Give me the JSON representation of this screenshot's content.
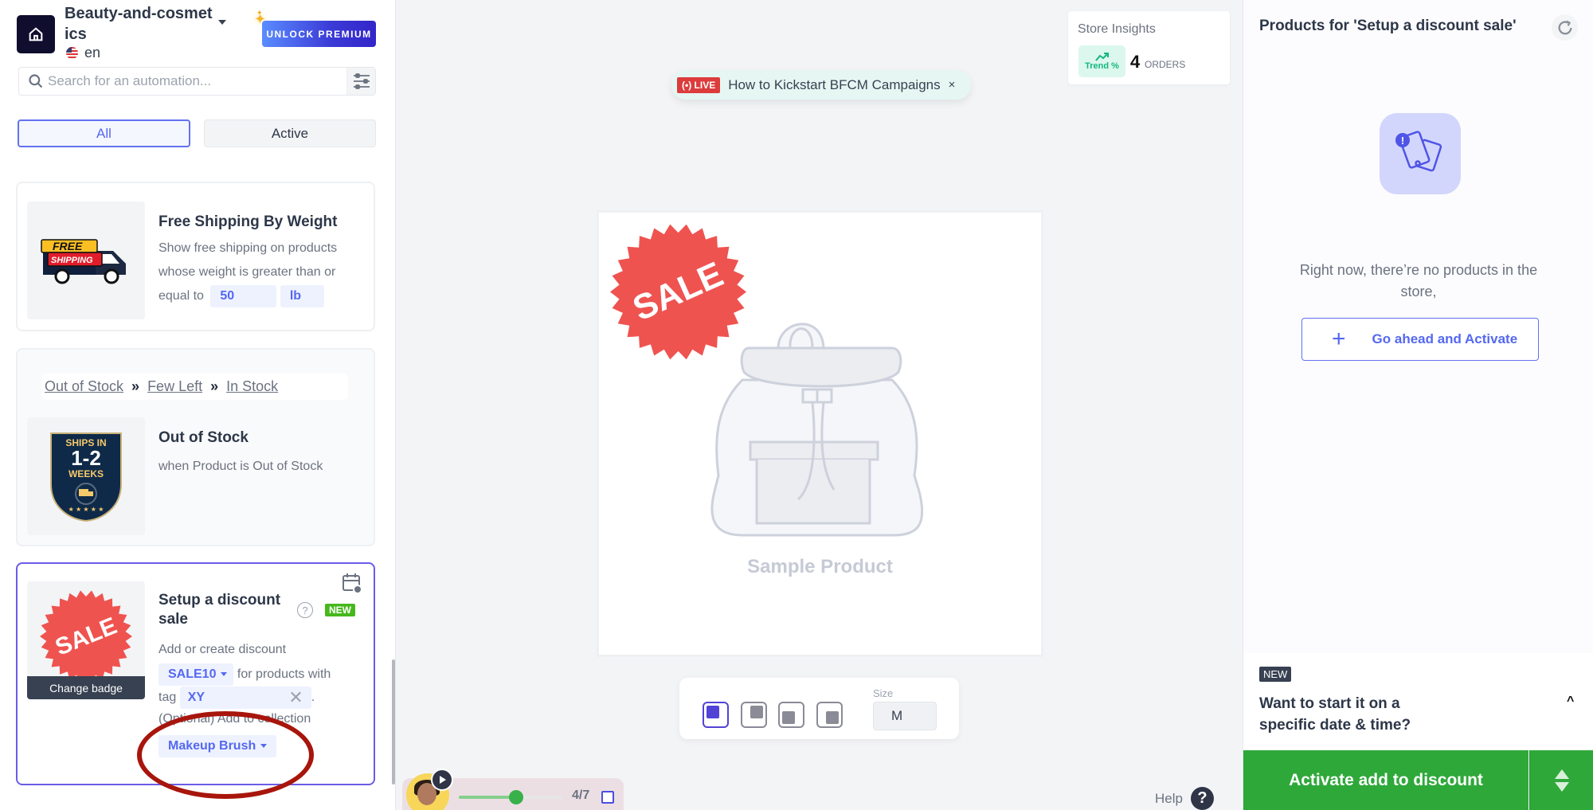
{
  "sidebar": {
    "store_name": "Beauty-and-cosmetics",
    "language": "en",
    "premium_label": "UNLOCK PREMIUM",
    "search_placeholder": "Search for an automation...",
    "search_value": "",
    "tabs": [
      {
        "label": "All",
        "selected": true
      },
      {
        "label": "Active",
        "selected": false
      }
    ],
    "automations": [
      {
        "title": "Free Shipping By Weight",
        "desc_prefix": "Show free shipping on products whose weight is greater than or equal to",
        "weight_value": "50",
        "weight_unit": "lb",
        "badge_icon": "free-shipping-truck-icon",
        "badge_text_1": "FREE",
        "badge_text_2": "SHIPPING"
      },
      {
        "flow": [
          "Out of Stock",
          "Few Left",
          "In Stock"
        ],
        "flow_separator": "»",
        "title": "Out of Stock",
        "desc": "when Product is Out of Stock",
        "badge_text_1": "SHIPS IN",
        "badge_text_2": "1-2",
        "badge_text_3": "WEEKS"
      },
      {
        "title": "Setup a discount sale",
        "new_badge": "NEW",
        "help": "?",
        "desc_1": "Add or create discount",
        "discount_code": "SALE10",
        "desc_2": "for products with",
        "tag_label": "tag",
        "tag_value": "XY",
        "tag_suffix": ".",
        "collection_label": "(Optional) Add to collection",
        "collection_value": "Makeup Brush",
        "badge_text": "SALE",
        "change_badge_label": "Change badge",
        "selected": true
      }
    ]
  },
  "center": {
    "live_tag": "LIVE",
    "live_title": "How to Kickstart BFCM Campaigns",
    "live_close": "×",
    "insights": {
      "title": "Store Insights",
      "trend_label": "Trend %",
      "orders_count": "4",
      "orders_label": "ORDERS"
    },
    "preview": {
      "badge_text": "SALE",
      "product_label": "Sample Product"
    },
    "toolbar": {
      "positions": [
        "top-left",
        "top-right",
        "bottom-left",
        "bottom-right"
      ],
      "selected_position": "top-left",
      "size_label": "Size",
      "size_value": "M"
    },
    "player": {
      "progress_fraction": 0.55,
      "step_label": "4/7"
    },
    "help_label": "Help",
    "help_icon": "?"
  },
  "right_panel": {
    "title": "Products for 'Setup a discount sale'",
    "empty_text": "Right now, there’re no products in the store,",
    "activate_outline_label": "Go ahead and Activate",
    "activate_outline_icon": "+",
    "schedule_badge": "NEW",
    "schedule_question": "Want to start it on a specific date & time?",
    "schedule_caret": "^",
    "activate_main_label": "Activate add to discount"
  },
  "colors": {
    "accent": "#5468f0",
    "selected_border": "#6b5ce7",
    "activate_green": "#2fa83a",
    "sale_red": "#ef5350",
    "live_red": "#dc3c3c",
    "annotation_red": "#a8150c"
  }
}
